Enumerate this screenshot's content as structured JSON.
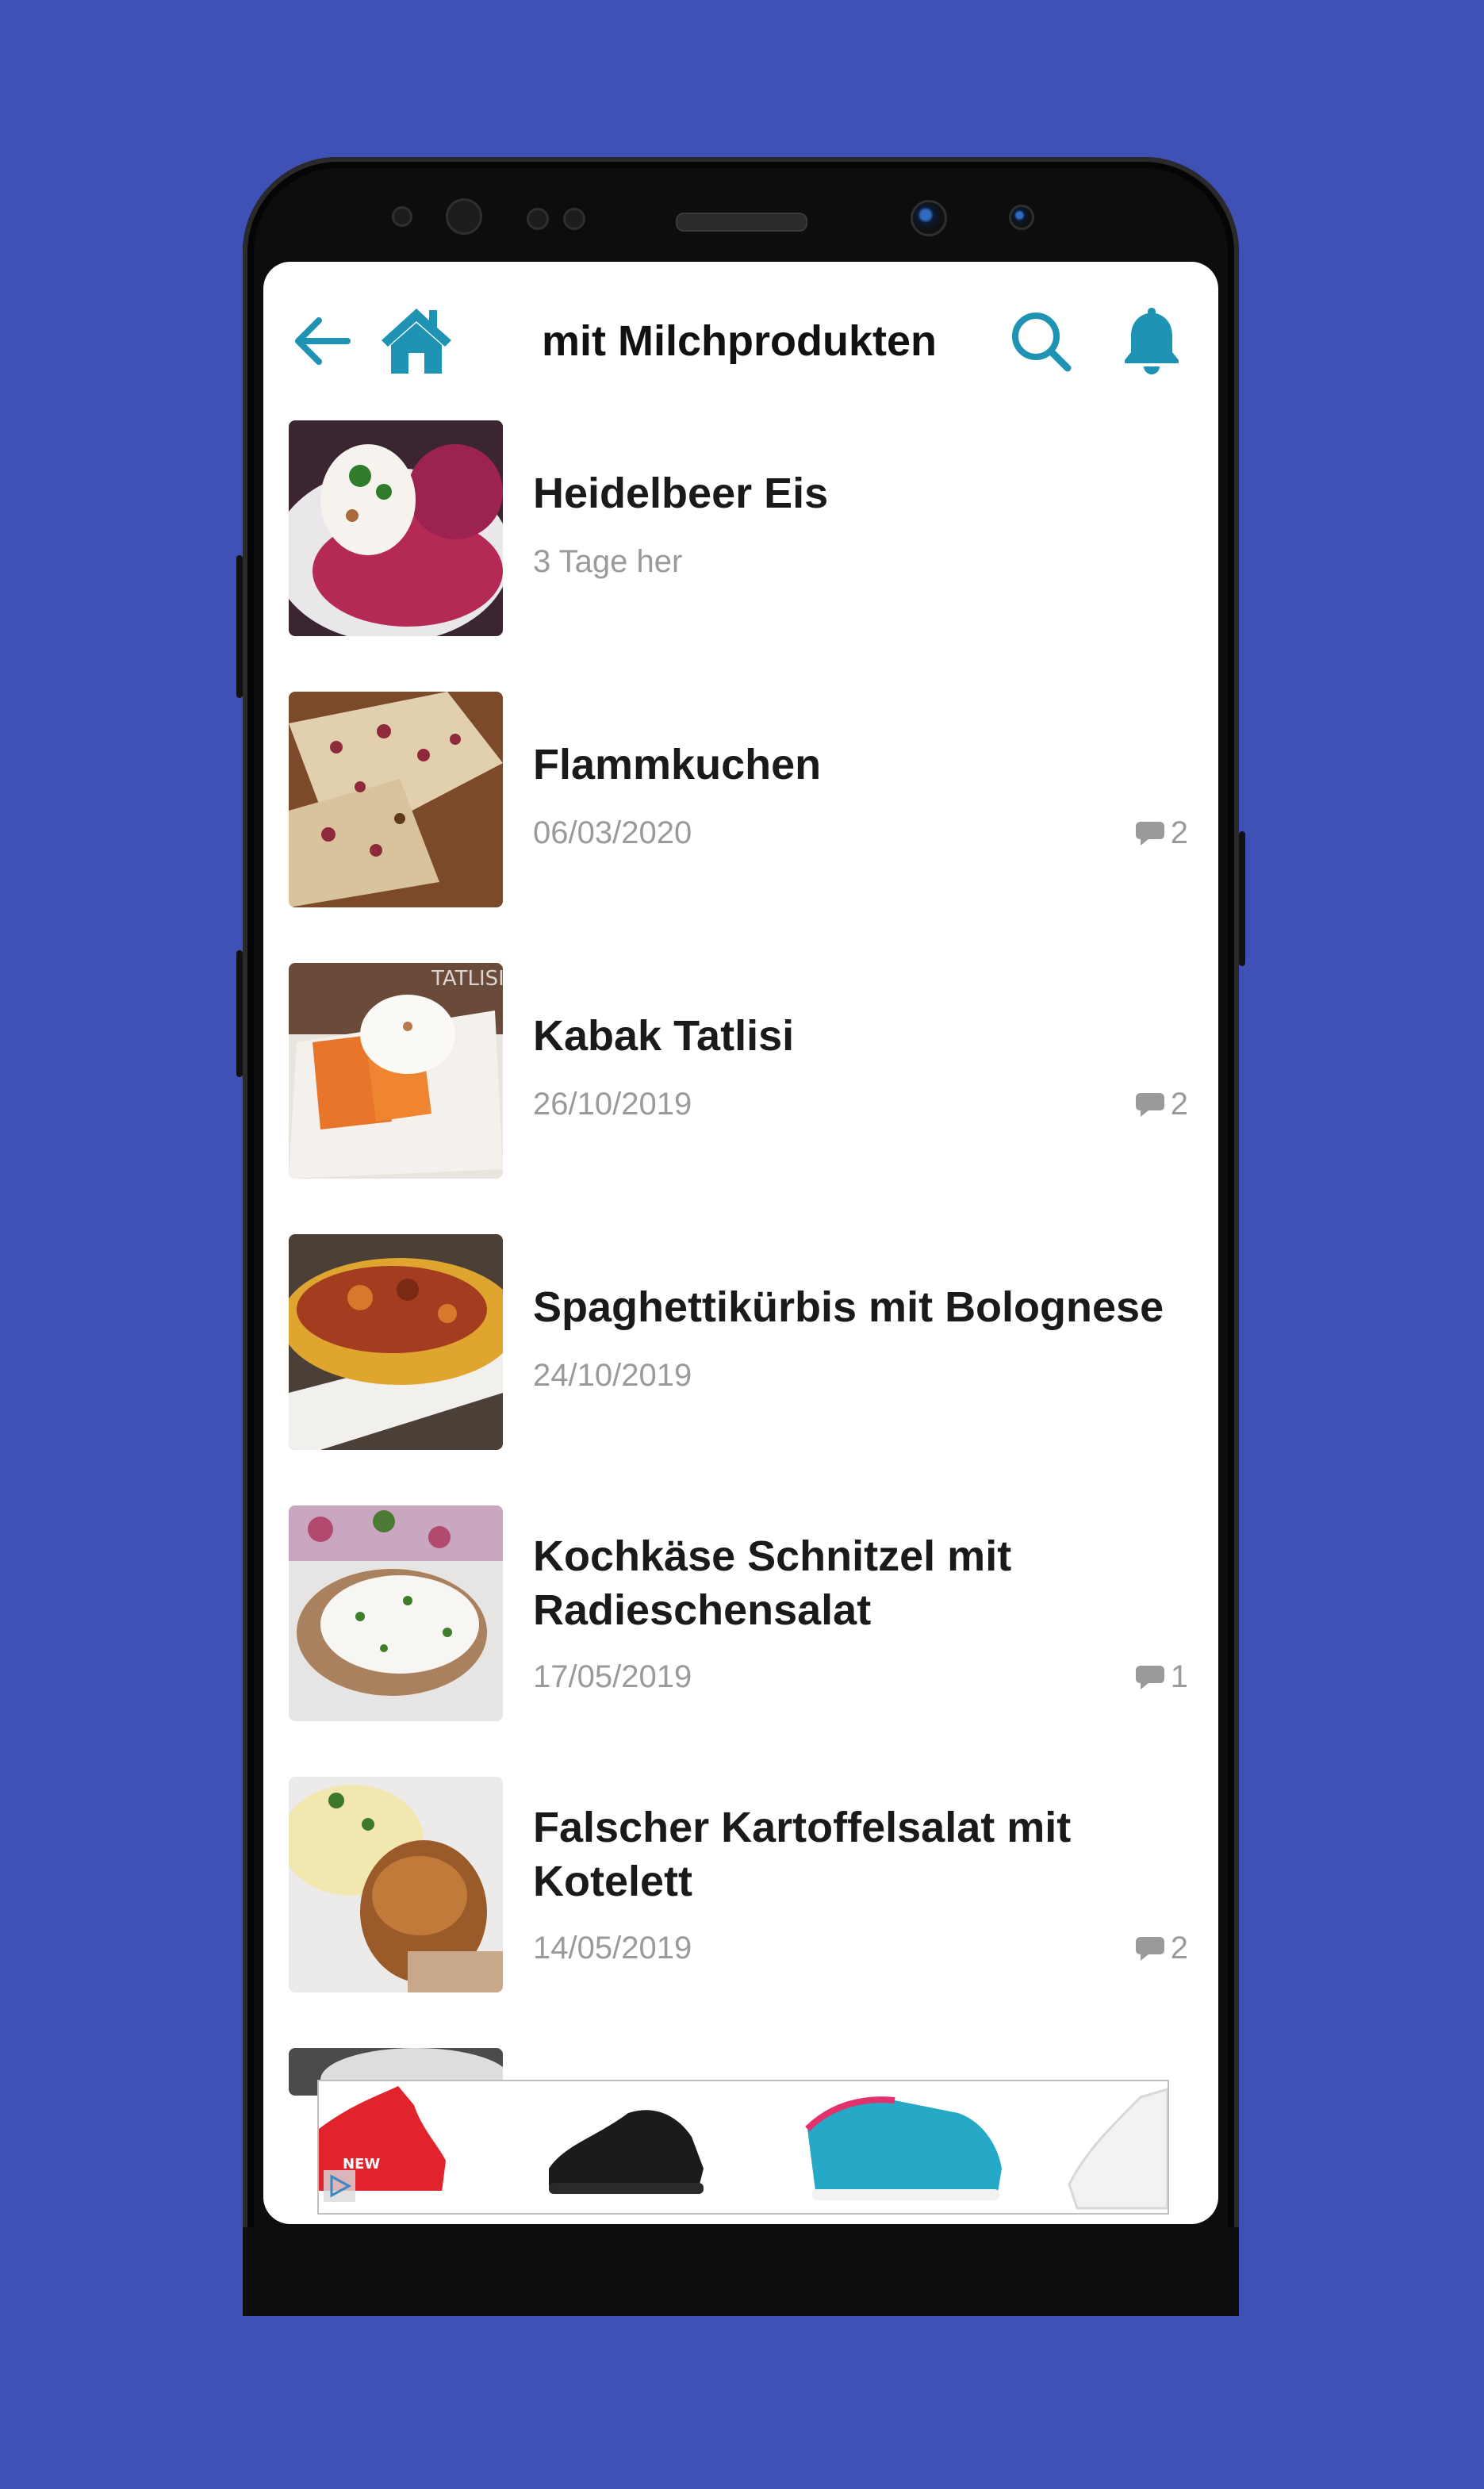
{
  "app": {
    "title": "mit Milchprodukten",
    "accent_color": "#1f93b4",
    "background_color": "#3f51b5"
  },
  "toolbar": {
    "back_icon": "arrow-left-icon",
    "home_icon": "home-icon",
    "search_icon": "search-icon",
    "notification_icon": "bell-icon"
  },
  "recipes": [
    {
      "title": "Heidelbeer Eis",
      "date": "3 Tage her",
      "comments": ""
    },
    {
      "title": "Flammkuchen",
      "date": "06/03/2020",
      "comments": "2"
    },
    {
      "title": "Kabak Tatlisi",
      "date": "26/10/2019",
      "comments": "2"
    },
    {
      "title": "Spaghettikürbis mit Bolognese",
      "date": "24/10/2019",
      "comments": ""
    },
    {
      "title": "Kochkäse Schnitzel mit Radieschensalat",
      "date": "17/05/2019",
      "comments": "1"
    },
    {
      "title": "Falscher Kartoffelsalat mit Kotelett",
      "date": "14/05/2019",
      "comments": "2"
    }
  ],
  "thumbnail_text": {
    "kabak": "TATLISI"
  },
  "ad": {
    "products": [
      "red-sneaker",
      "black-sneaker",
      "teal-pink-sneaker",
      "white-sneaker"
    ],
    "badge_icon": "ad-choices-icon",
    "sneaker_text": "NEW"
  }
}
